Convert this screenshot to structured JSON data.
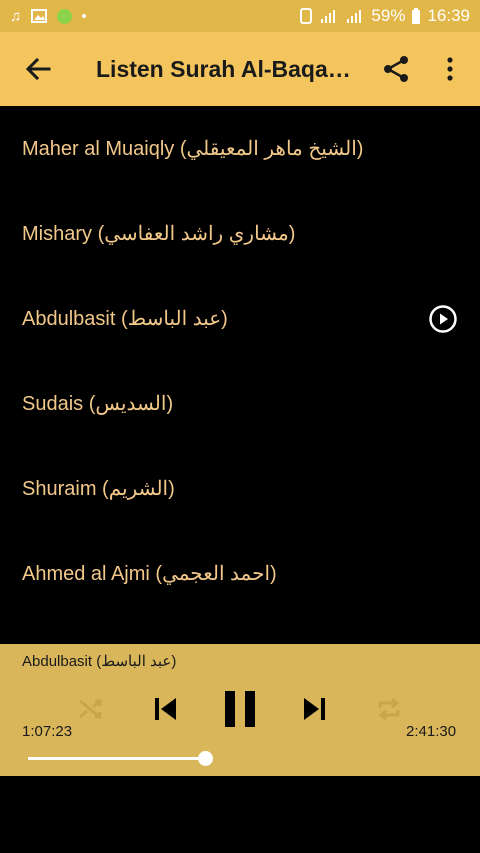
{
  "statusbar": {
    "battery": "59%",
    "time": "16:39"
  },
  "toolbar": {
    "title": "Listen Surah Al-Baqarah"
  },
  "reciters": [
    {
      "label": "Maher al Muaiqly (الشيخ ماهر المعيقلي)",
      "playing": false
    },
    {
      "label": "Mishary (مشاري راشد العفاسي)",
      "playing": false
    },
    {
      "label": "Abdulbasit (عبد الباسط)",
      "playing": true
    },
    {
      "label": "Sudais (السديس)",
      "playing": false
    },
    {
      "label": "Shuraim (الشريم)",
      "playing": false
    },
    {
      "label": "Ahmed al Ajmi (احمد العجمي)",
      "playing": false
    }
  ],
  "player": {
    "now_playing": "Abdulbasit (عبد الباسط)",
    "current_time": "1:07:23",
    "total_time": "2:41:30",
    "progress": 0.417
  },
  "colors": {
    "statusbar": "#e2b74a",
    "toolbar": "#f3c55c",
    "player": "#d9b65a",
    "list_text": "#f2c88a"
  }
}
